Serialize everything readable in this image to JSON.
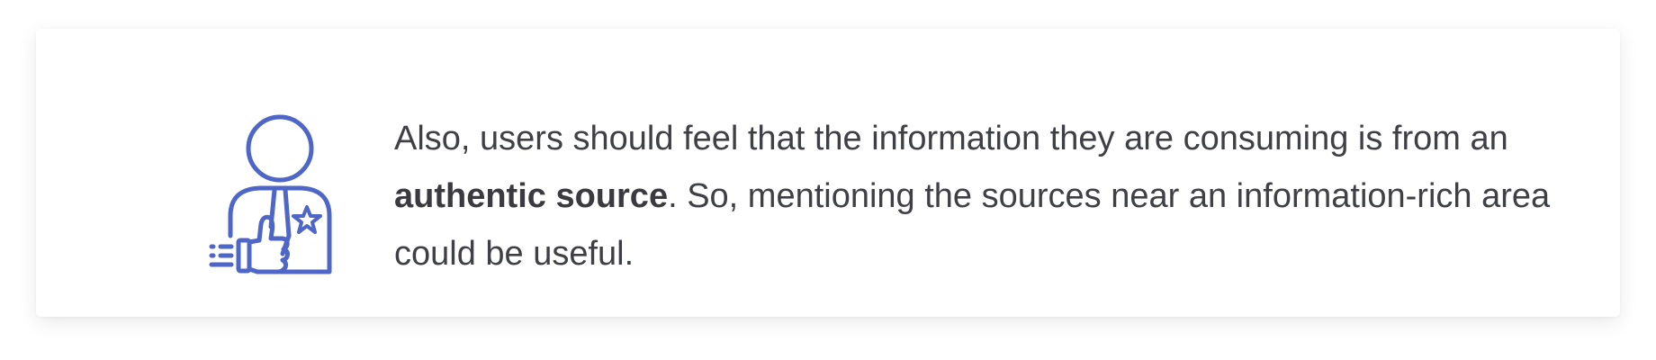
{
  "callout": {
    "icon": "user-thumbs-up-badge-icon",
    "accent_color": "#4d66c7",
    "text_color": "#3f3f46",
    "text_before": "Also, users should feel that the information they are consuming is from an ",
    "text_bold": "authentic source",
    "text_after": ". So, mentioning the sources near an information-rich area could be useful."
  }
}
